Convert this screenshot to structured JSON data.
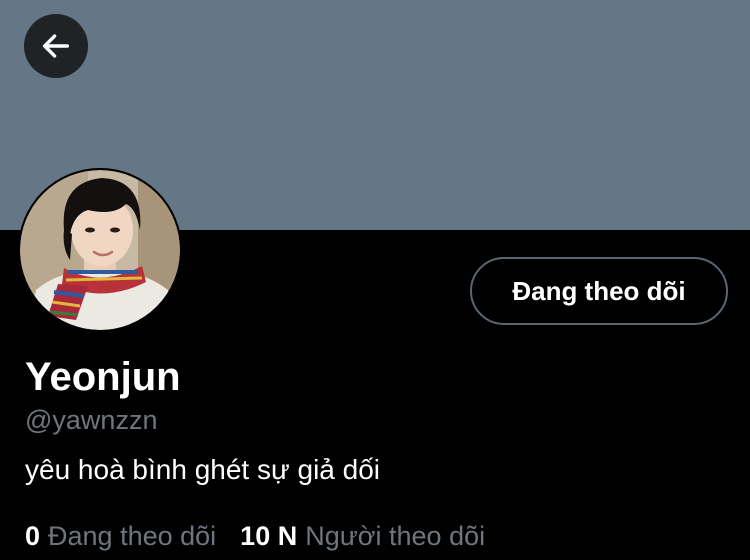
{
  "header": {
    "back_icon": "arrow-left-icon",
    "banner_color": "#657786"
  },
  "profile": {
    "display_name": "Yeonjun",
    "handle": "@yawnzzn",
    "bio": "yêu hoà bình ghét sự giả dối",
    "follow_button_label": "Đang theo dõi"
  },
  "stats": {
    "following_count": "0",
    "following_label": "Đang theo dõi",
    "followers_count": "10 N",
    "followers_label": "Người theo dõi"
  },
  "colors": {
    "background": "#000000",
    "primary_text": "#ffffff",
    "secondary_text": "#6e767d",
    "button_border": "#5b6670"
  }
}
